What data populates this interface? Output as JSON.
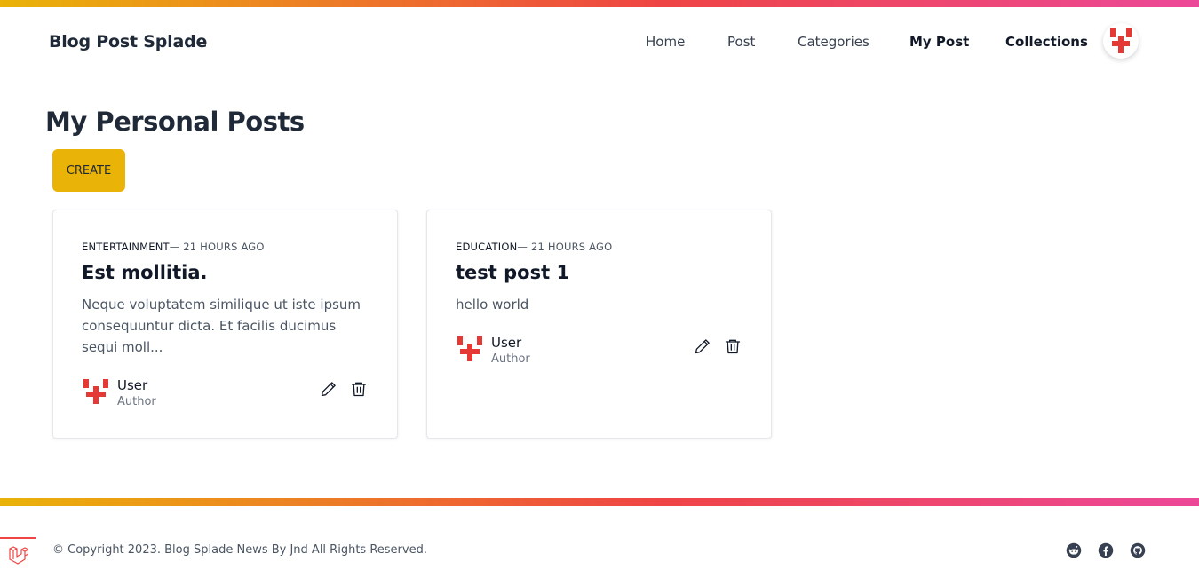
{
  "header": {
    "brand": "Blog Post Splade",
    "nav": [
      {
        "label": "Home"
      },
      {
        "label": "Post"
      },
      {
        "label": "Categories"
      },
      {
        "label": "My Post"
      },
      {
        "label": "Collections"
      }
    ]
  },
  "main": {
    "title": "My Personal Posts",
    "create_label": "CREATE",
    "posts": [
      {
        "category": "ENTERTAINMENT",
        "time": "— 21 HOURS AGO",
        "title": "Est mollitia.",
        "excerpt": "Neque voluptatem similique ut iste ipsum consequuntur dicta. Et facilis ducimus sequi moll...",
        "author": "User",
        "role": "Author"
      },
      {
        "category": "EDUCATION",
        "time": "— 21 HOURS AGO",
        "title": "test post 1",
        "excerpt": "hello world",
        "author": "User",
        "role": "Author"
      }
    ]
  },
  "footer": {
    "copyright": "© Copyright 2023. Blog Splade News By Jnd All Rights Reserved.",
    "social_icons": [
      "reddit-icon",
      "facebook-icon",
      "github-icon"
    ]
  },
  "colors": {
    "accent": "#eab308",
    "gradient_start": "#eab308",
    "gradient_mid": "#ef4444",
    "gradient_end": "#ec4899",
    "avatar_red": "#e53935"
  }
}
